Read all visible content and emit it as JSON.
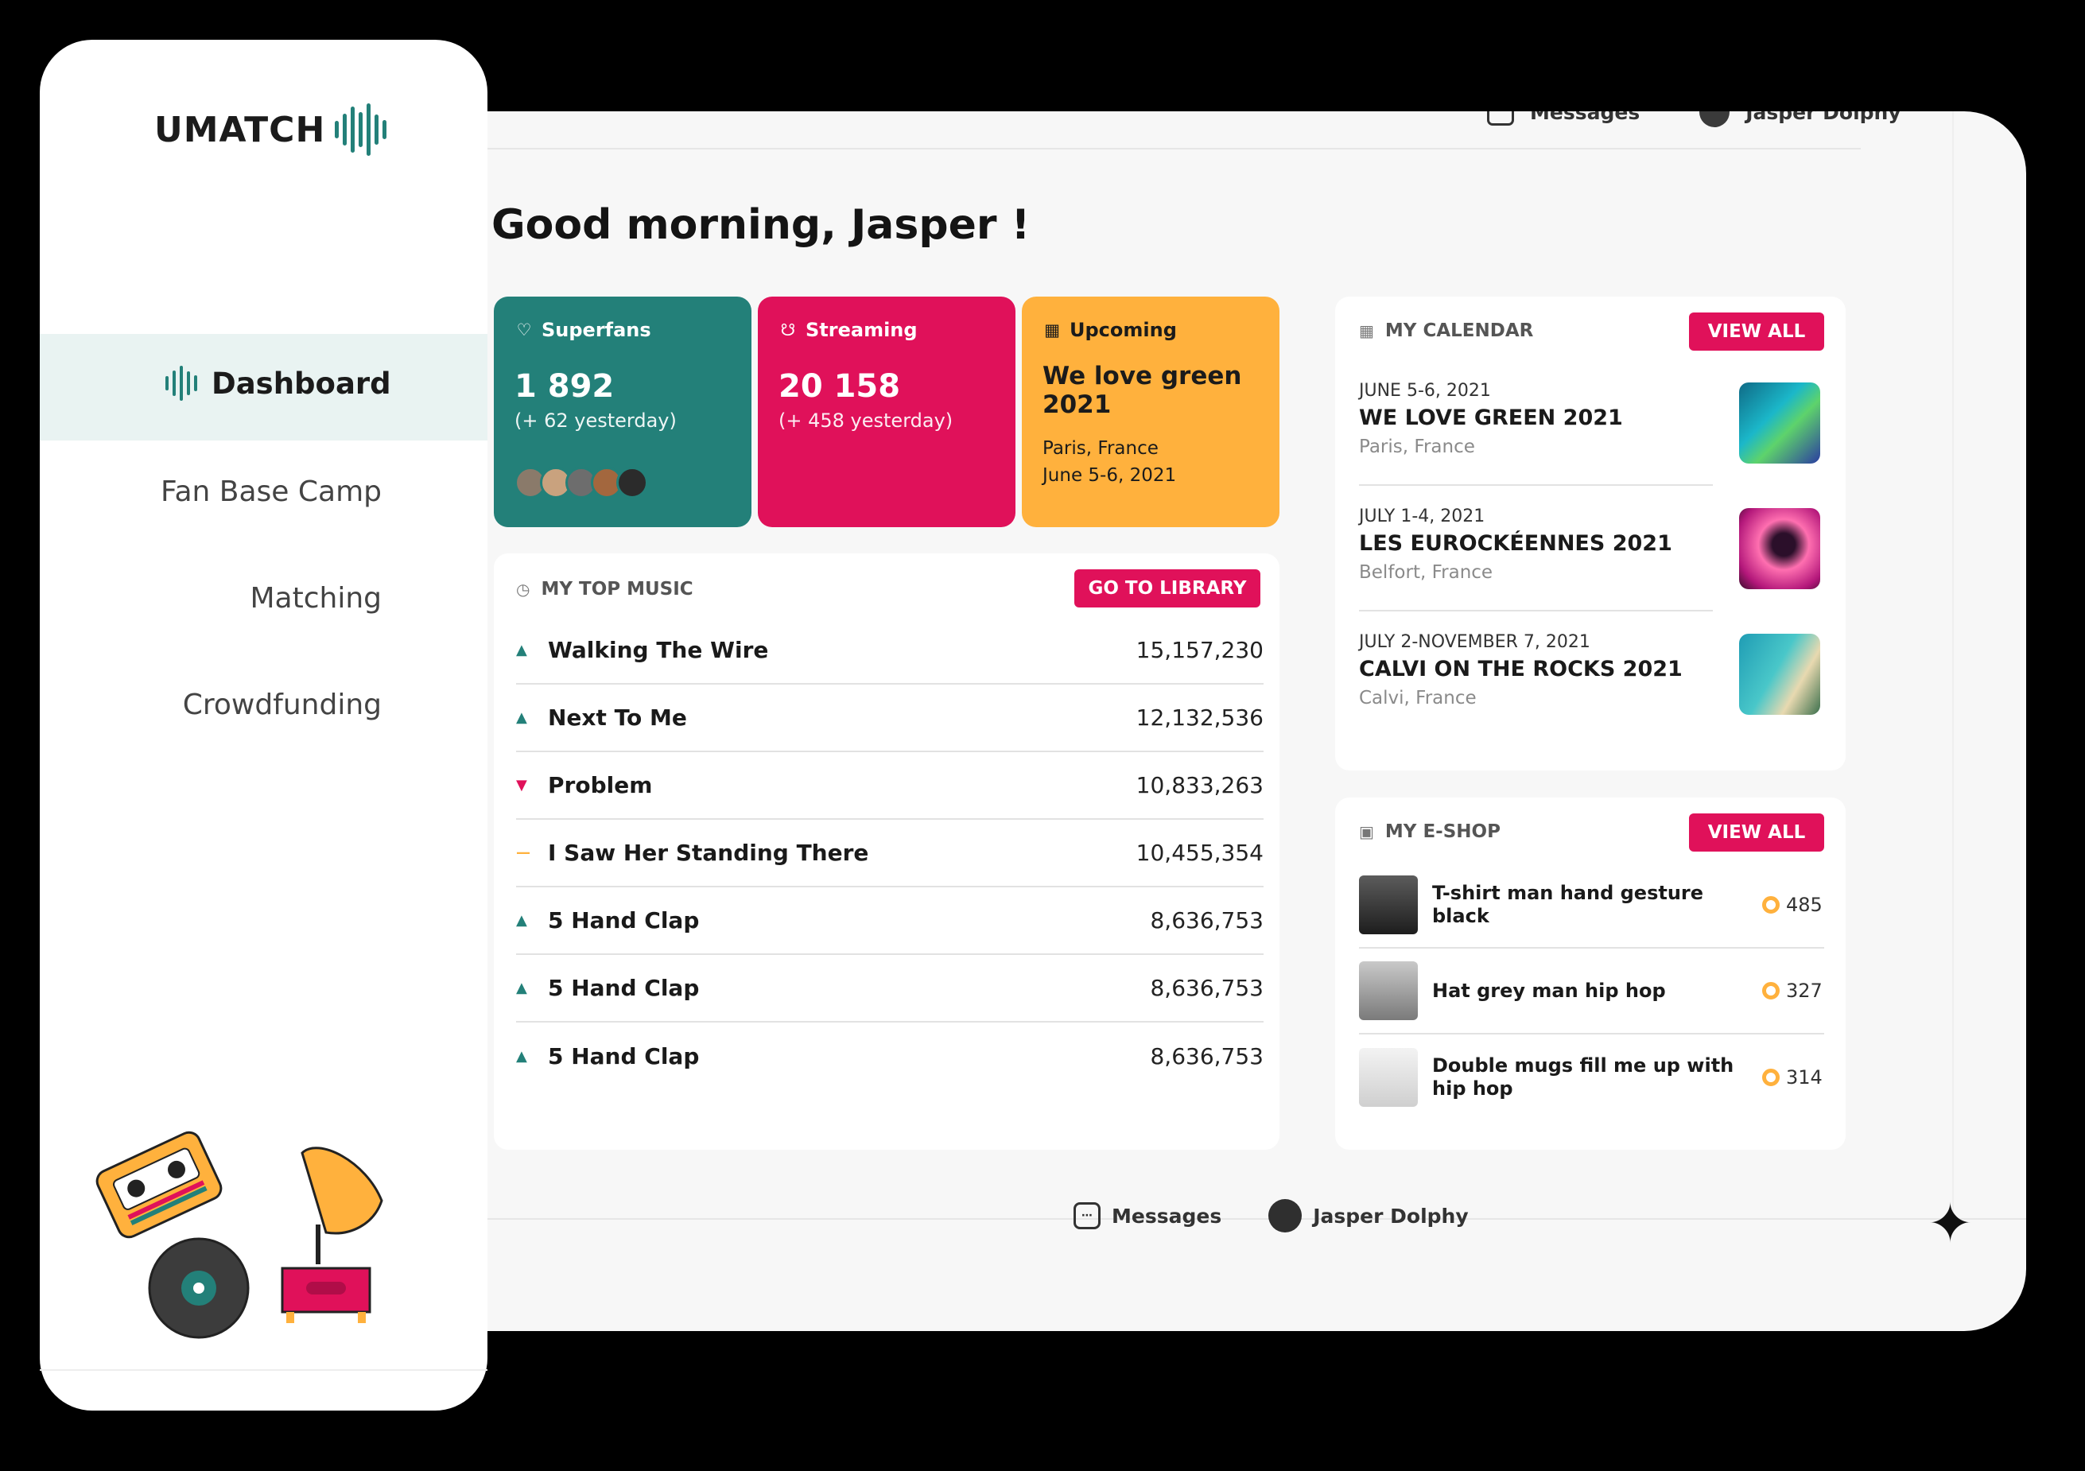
{
  "colors": {
    "teal": "#238079",
    "pink": "#e0115a",
    "amber": "#ffb13d"
  },
  "sidebar": {
    "brand": "UMATCH",
    "nav": {
      "dashboard": "Dashboard",
      "fanbase": "Fan Base Camp",
      "matching": "Matching",
      "crowdfunding": "Crowdfunding"
    }
  },
  "top_bar": {
    "messages": "Messages",
    "user": "Jasper Dolphy"
  },
  "greeting": "Good morning, Jasper !",
  "stats": {
    "superfans": {
      "label": "Superfans",
      "value": "1 892",
      "delta": "(+ 62 yesterday)"
    },
    "streaming": {
      "label": "Streaming",
      "value": "20 158",
      "delta": "(+ 458 yesterday)"
    },
    "upcoming": {
      "label": "Upcoming",
      "title": "We love green 2021",
      "place": "Paris, France",
      "date": "June 5-6, 2021"
    }
  },
  "top_music": {
    "title": "MY TOP MUSIC",
    "button": "GO TO LIBRARY",
    "tracks": [
      {
        "name": "Walking The Wire",
        "plays": "15,157,230",
        "trend": "up"
      },
      {
        "name": "Next To Me",
        "plays": "12,132,536",
        "trend": "up"
      },
      {
        "name": "Problem",
        "plays": "10,833,263",
        "trend": "down"
      },
      {
        "name": "I Saw Her Standing There",
        "plays": "10,455,354",
        "trend": "flat"
      },
      {
        "name": "5 Hand Clap",
        "plays": "8,636,753",
        "trend": "up"
      },
      {
        "name": "5 Hand Clap",
        "plays": "8,636,753",
        "trend": "up"
      },
      {
        "name": "5 Hand Clap",
        "plays": "8,636,753",
        "trend": "up"
      }
    ]
  },
  "calendar": {
    "title": "MY CALENDAR",
    "button": "VIEW ALL",
    "events": [
      {
        "date": "JUNE 5-6, 2021",
        "title": "WE LOVE GREEN 2021",
        "place": "Paris, France"
      },
      {
        "date": "JULY 1-4, 2021",
        "title": "LES EUROCKÉENNES 2021",
        "place": "Belfort, France"
      },
      {
        "date": "JULY 2-NOVEMBER 7, 2021",
        "title": "CALVI ON THE ROCKS 2021",
        "place": "Calvi, France"
      }
    ]
  },
  "eshop": {
    "title": "MY E-SHOP",
    "button": "VIEW ALL",
    "items": [
      {
        "name": "T-shirt man hand gesture black",
        "points": "485"
      },
      {
        "name": "Hat grey man hip hop",
        "points": "327"
      },
      {
        "name": "Double mugs fill me up with hip hop",
        "points": "314"
      }
    ]
  }
}
